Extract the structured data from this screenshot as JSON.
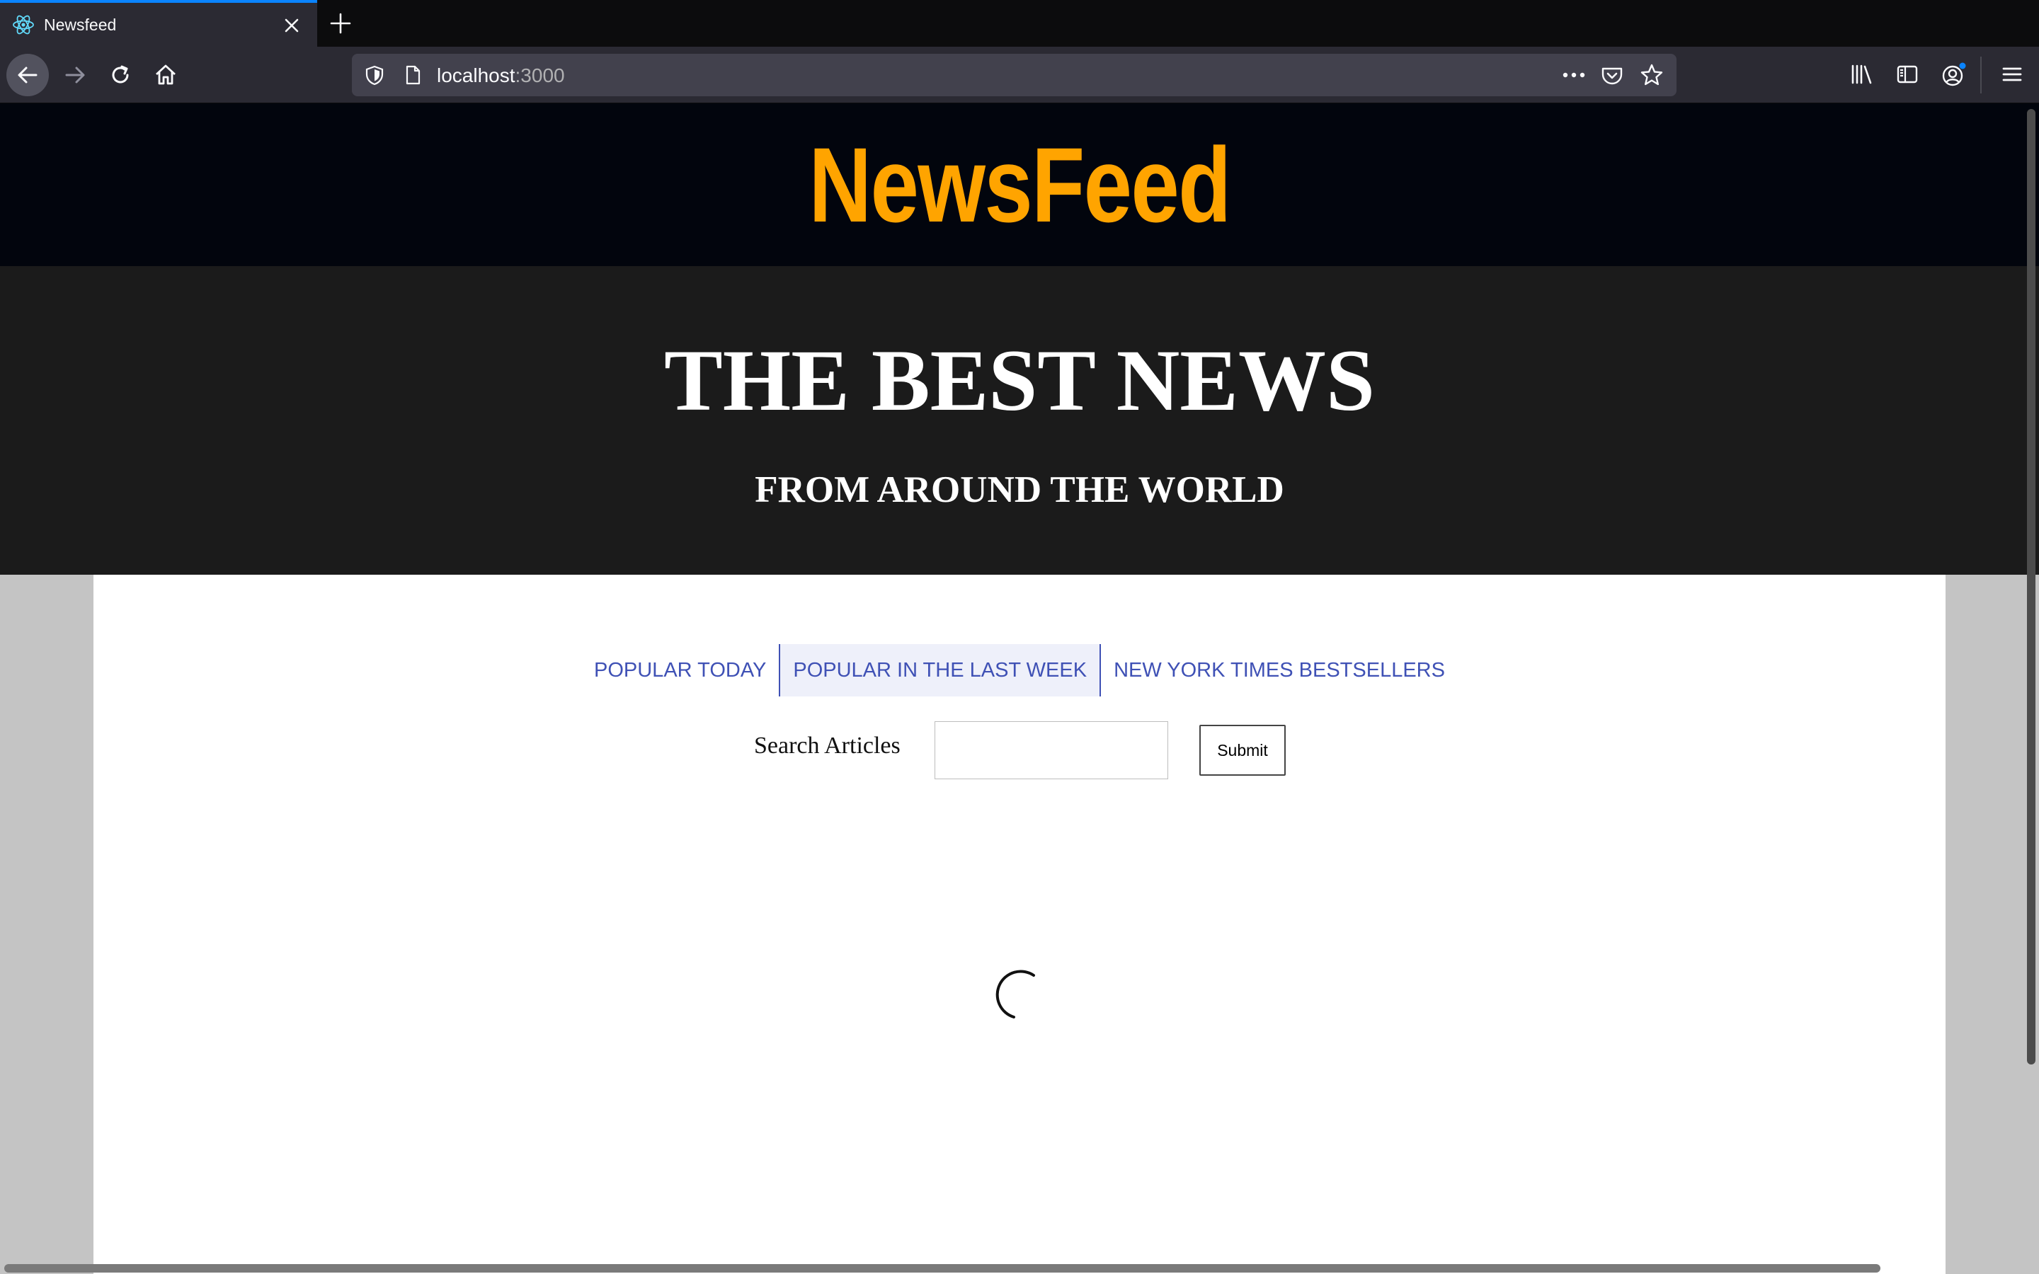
{
  "browser": {
    "tab": {
      "title": "Newsfeed",
      "favicon": "react-icon"
    },
    "url": {
      "host": "localhost",
      "port": ":3000"
    },
    "accent_color": "#0a84ff"
  },
  "site": {
    "logo": "NewsFeed",
    "logo_color": "#ffa400",
    "hero_title": "THE BEST NEWS",
    "hero_subtitle": "FROM AROUND THE WORLD",
    "tabs": [
      {
        "label": "POPULAR TODAY",
        "active": false
      },
      {
        "label": "POPULAR IN THE LAST WEEK",
        "active": true
      },
      {
        "label": "NEW YORK TIMES BESTSELLERS",
        "active": false
      }
    ],
    "tab_color": "#3f51b5",
    "search": {
      "label": "Search Articles",
      "value": "",
      "placeholder": ""
    },
    "submit_label": "Submit",
    "loading": true
  }
}
